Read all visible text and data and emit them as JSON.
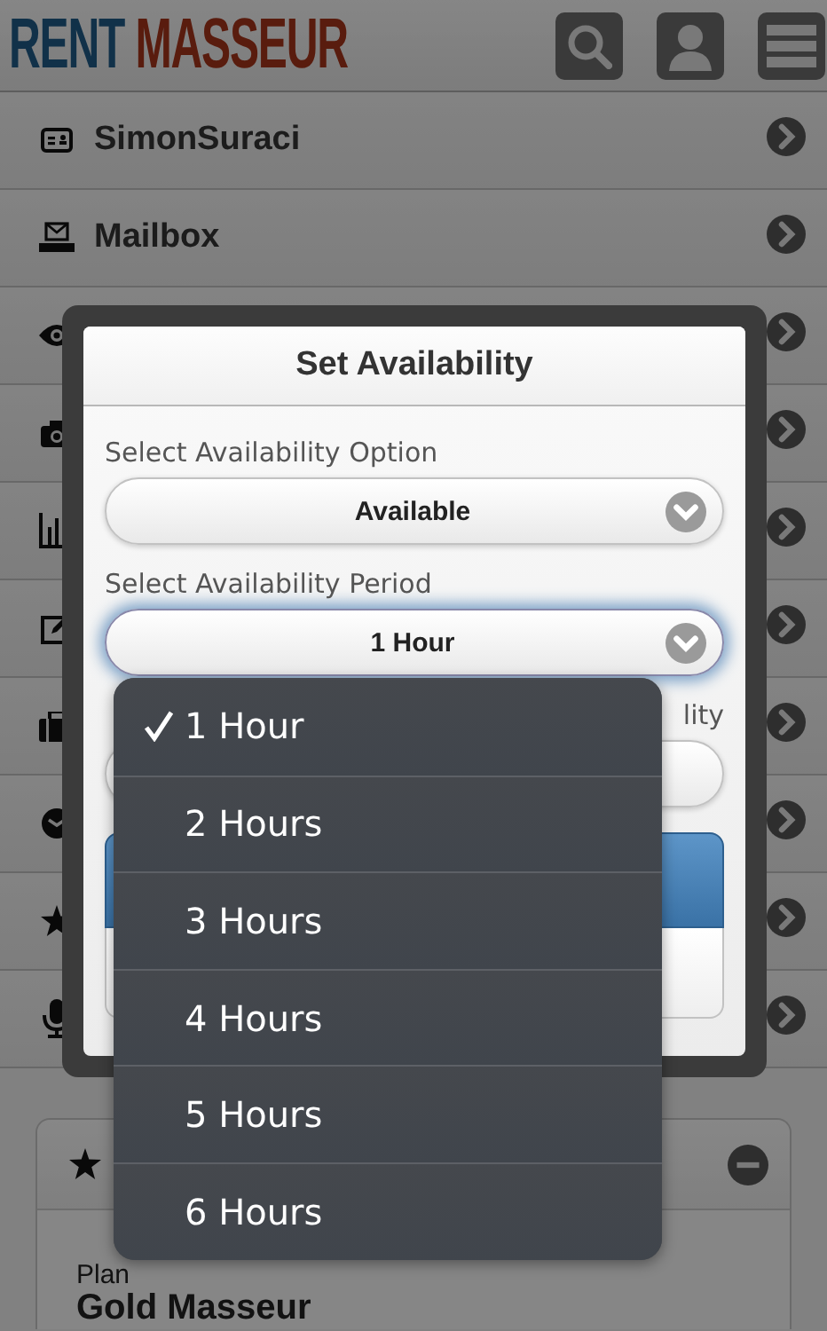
{
  "header": {
    "logo": {
      "word_1": "RENT",
      "word_2": "MASSEUR"
    },
    "buttons": [
      {
        "kind": "search"
      },
      {
        "kind": "profile"
      },
      {
        "kind": "menu"
      }
    ]
  },
  "menu": [
    {
      "label": "SimonSuraci",
      "kind": "idcard"
    },
    {
      "label": "Mailbox",
      "kind": "inbox"
    },
    {
      "kind": "eye"
    },
    {
      "kind": "camera"
    },
    {
      "kind": "chart"
    },
    {
      "kind": "edit"
    },
    {
      "kind": "briefcase"
    },
    {
      "kind": "clock"
    },
    {
      "kind": "star"
    },
    {
      "kind": "mic"
    }
  ],
  "card": {
    "label": "Plan",
    "plan": "Gold Masseur"
  },
  "dialog": {
    "title": "Set Availability",
    "fields": [
      {
        "label": "Select Availability Option",
        "value": "Available",
        "focused": false
      },
      {
        "label": "Select Availability Period",
        "value": "1 Hour",
        "focused": true
      }
    ],
    "covered_label": {
      "end": "lity"
    }
  },
  "picker": {
    "options": [
      {
        "label": "1 Hour",
        "selected": true
      },
      {
        "label": "2 Hours",
        "selected": false
      },
      {
        "label": "3 Hours",
        "selected": false
      },
      {
        "label": "4 Hours",
        "selected": false
      },
      {
        "label": "5 Hours",
        "selected": false
      },
      {
        "label": "6 Hours",
        "selected": false
      }
    ]
  }
}
